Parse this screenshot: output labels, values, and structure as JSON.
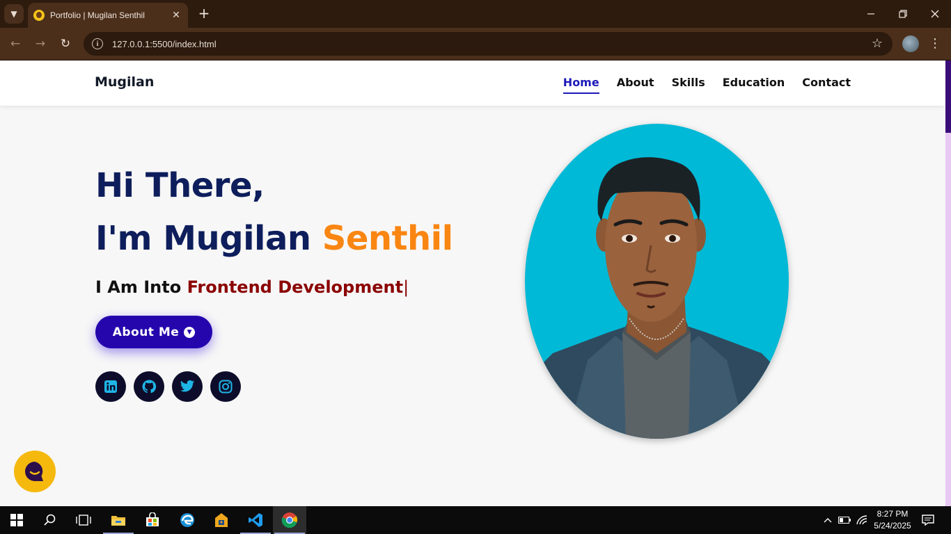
{
  "browser": {
    "tab_title": "Portfolio | Mugilan Senthil",
    "url": "127.0.0.1:5500/index.html"
  },
  "site": {
    "logo": "Mugilan",
    "nav": [
      {
        "label": "Home",
        "active": true
      },
      {
        "label": "About"
      },
      {
        "label": "Skills"
      },
      {
        "label": "Education"
      },
      {
        "label": "Contact"
      }
    ]
  },
  "hero": {
    "greeting": "Hi There,",
    "name_prefix": "I'm Mugilan ",
    "name_accent": "Senthil",
    "typed_prefix": "I Am Into ",
    "typed_value": "Frontend Development",
    "typed_caret": "|",
    "button_label": "About Me",
    "socials": [
      "linkedin-icon",
      "github-icon",
      "twitter-icon",
      "instagram-icon"
    ]
  },
  "colors": {
    "heading": "#0e1e5c",
    "accent": "#f98612",
    "typed": "#8b0000",
    "button": "#2506ad",
    "nav_active": "#1d1ab8",
    "photo_bg": "#00b9d6"
  },
  "taskbar": {
    "time": "8:27 PM",
    "date": "5/24/2025",
    "apps": [
      "start-icon",
      "search-icon",
      "task-view-icon",
      "file-explorer-icon",
      "microsoft-store-icon",
      "edge-icon",
      "vpn-icon",
      "vscode-icon",
      "chrome-icon"
    ]
  }
}
